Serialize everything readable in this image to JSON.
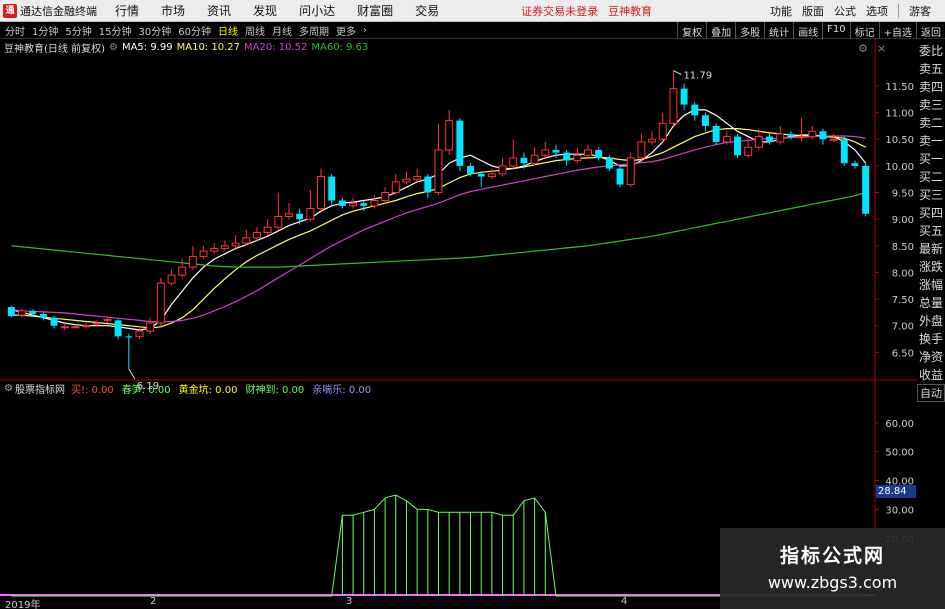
{
  "titlebar": {
    "app_name": "通达信金融终端",
    "menus": [
      "行情",
      "市场",
      "资讯",
      "发现",
      "问小达",
      "财富圈",
      "交易"
    ],
    "notice": "证券交易未登录",
    "notice2": "豆神教育",
    "right_items": [
      "功能",
      "版面",
      "公式",
      "选项",
      "游客"
    ]
  },
  "toolbar": {
    "periods": [
      "分时",
      "1分钟",
      "5分钟",
      "15分钟",
      "30分钟",
      "60分钟",
      "日线",
      "周线",
      "月线",
      "多周期",
      "更多"
    ],
    "active_period": "日线",
    "right_buttons": [
      "复权",
      "叠加",
      "多股",
      "统计",
      "画线",
      "F10",
      "标记",
      "+自选",
      "返回"
    ]
  },
  "info": {
    "stock": "豆神教育(日线 前复权)",
    "ma5": "MA5: 9.99",
    "ma10": "MA10: 10.27",
    "ma20": "MA20: 10.52",
    "ma60": "MA60: 9.63"
  },
  "colors": {
    "up": "#ff3333",
    "down": "#00e5ff",
    "ma5": "#ffffff",
    "ma10": "#ffff66",
    "ma20": "#cc44cc",
    "ma60": "#33bb33",
    "indicator": "#66ff66",
    "axis": "#aa0000"
  },
  "price_axis": [
    "11.50",
    "11.00",
    "10.50",
    "10.00",
    "9.50",
    "9.00",
    "8.50",
    "8.00",
    "7.50",
    "7.00",
    "6.50"
  ],
  "price_annotations": {
    "high": "11.79",
    "low": "6.19"
  },
  "side_panel": [
    "委比",
    "卖五",
    "卖四",
    "卖三",
    "卖二",
    "卖一",
    "买一",
    "买二",
    "买三",
    "买四",
    "买五",
    "最新",
    "涨跌",
    "涨幅",
    "总量",
    "外盘",
    "换手",
    "净资",
    "收益"
  ],
  "auto_label": "自动",
  "indicator": {
    "name": "股票指标网",
    "fields": [
      {
        "label": "买!",
        "value": "0.00",
        "color": "#ff4444"
      },
      {
        "label": "春笋",
        "value": "0.00",
        "color": "#66ff66"
      },
      {
        "label": "黄金坑",
        "value": "0.00",
        "color": "#ffff00"
      },
      {
        "label": "财神到",
        "value": "0.00",
        "color": "#66ff66"
      },
      {
        "label": "亲喘乐",
        "value": "0.00",
        "color": "#9999ff"
      }
    ],
    "axis": [
      "60.00",
      "50.00",
      "40.00",
      "30.00",
      "20.00"
    ],
    "current": "28.84"
  },
  "xaxis": [
    {
      "label": "2019年"
    },
    {
      "label": "2"
    },
    {
      "label": "3"
    },
    {
      "label": "4"
    }
  ],
  "watermark": {
    "line1": "指标公式网",
    "line2": "www.zbgs3.com"
  },
  "chart_data": {
    "type": "candlestick",
    "ylim": [
      6.0,
      12.1
    ],
    "candles": [
      [
        7.35,
        7.18,
        7.38,
        7.15
      ],
      [
        7.2,
        7.28,
        7.32,
        7.15
      ],
      [
        7.28,
        7.22,
        7.3,
        7.18
      ],
      [
        7.22,
        7.15,
        7.25,
        7.1
      ],
      [
        7.15,
        7.0,
        7.18,
        6.95
      ],
      [
        6.98,
        6.98,
        7.05,
        6.92
      ],
      [
        6.98,
        6.98,
        7.02,
        6.95
      ],
      [
        6.98,
        7.0,
        7.05,
        6.95
      ],
      [
        7.05,
        7.05,
        7.1,
        7.0
      ],
      [
        7.1,
        7.12,
        7.18,
        7.05
      ],
      [
        7.1,
        6.8,
        7.12,
        6.75
      ],
      [
        6.8,
        6.78,
        6.85,
        6.19
      ],
      [
        6.8,
        6.9,
        7.0,
        6.75
      ],
      [
        6.9,
        7.05,
        7.15,
        6.85
      ],
      [
        7.05,
        7.8,
        7.9,
        7.0
      ],
      [
        7.8,
        7.95,
        8.05,
        7.75
      ],
      [
        7.95,
        8.1,
        8.25,
        7.9
      ],
      [
        8.1,
        8.3,
        8.5,
        8.05
      ],
      [
        8.3,
        8.4,
        8.5,
        8.25
      ],
      [
        8.4,
        8.45,
        8.55,
        8.35
      ],
      [
        8.45,
        8.5,
        8.6,
        8.4
      ],
      [
        8.5,
        8.55,
        8.7,
        8.45
      ],
      [
        8.55,
        8.65,
        8.8,
        8.5
      ],
      [
        8.65,
        8.75,
        8.85,
        8.6
      ],
      [
        8.75,
        8.85,
        9.0,
        8.7
      ],
      [
        8.85,
        9.05,
        9.5,
        8.8
      ],
      [
        9.05,
        9.1,
        9.3,
        9.0
      ],
      [
        9.1,
        9.0,
        9.2,
        8.9
      ],
      [
        9.0,
        9.2,
        9.55,
        8.95
      ],
      [
        9.2,
        9.8,
        9.95,
        9.15
      ],
      [
        9.8,
        9.35,
        9.85,
        9.25
      ],
      [
        9.35,
        9.25,
        9.4,
        9.2
      ],
      [
        9.25,
        9.3,
        9.4,
        9.2
      ],
      [
        9.3,
        9.25,
        9.35,
        9.15
      ],
      [
        9.25,
        9.35,
        9.45,
        9.2
      ],
      [
        9.35,
        9.5,
        9.6,
        9.3
      ],
      [
        9.5,
        9.7,
        9.85,
        9.45
      ],
      [
        9.7,
        9.75,
        9.9,
        9.65
      ],
      [
        9.75,
        9.8,
        9.95,
        9.7
      ],
      [
        9.8,
        9.5,
        9.85,
        9.4
      ],
      [
        9.5,
        10.3,
        10.8,
        9.45
      ],
      [
        10.3,
        10.85,
        11.05,
        10.2
      ],
      [
        10.85,
        10.0,
        10.9,
        9.9
      ],
      [
        10.0,
        9.85,
        10.05,
        9.8
      ],
      [
        9.85,
        9.8,
        9.9,
        9.6
      ],
      [
        9.8,
        9.85,
        9.95,
        9.75
      ],
      [
        9.85,
        10.0,
        10.15,
        9.8
      ],
      [
        10.0,
        10.15,
        10.5,
        9.95
      ],
      [
        10.15,
        10.05,
        10.25,
        9.95
      ],
      [
        10.05,
        10.2,
        10.35,
        10.0
      ],
      [
        10.2,
        10.3,
        10.45,
        10.15
      ],
      [
        10.3,
        10.25,
        10.4,
        10.15
      ],
      [
        10.25,
        10.1,
        10.3,
        10.0
      ],
      [
        10.1,
        10.2,
        10.35,
        10.05
      ],
      [
        10.2,
        10.3,
        10.4,
        10.15
      ],
      [
        10.3,
        10.15,
        10.35,
        10.1
      ],
      [
        10.15,
        9.95,
        10.2,
        9.9
      ],
      [
        9.95,
        9.65,
        10.0,
        9.6
      ],
      [
        9.65,
        10.15,
        10.25,
        9.6
      ],
      [
        10.15,
        10.45,
        10.6,
        10.1
      ],
      [
        10.45,
        10.5,
        10.65,
        10.4
      ],
      [
        10.5,
        10.8,
        11.0,
        10.45
      ],
      [
        10.8,
        11.45,
        11.79,
        10.75
      ],
      [
        11.45,
        11.15,
        11.55,
        11.05
      ],
      [
        11.15,
        10.95,
        11.2,
        10.85
      ],
      [
        10.95,
        10.75,
        11.0,
        10.65
      ],
      [
        10.75,
        10.45,
        10.8,
        10.4
      ],
      [
        10.45,
        10.55,
        10.65,
        10.4
      ],
      [
        10.55,
        10.2,
        10.6,
        10.15
      ],
      [
        10.2,
        10.35,
        10.5,
        10.15
      ],
      [
        10.35,
        10.55,
        10.7,
        10.3
      ],
      [
        10.55,
        10.45,
        10.6,
        10.4
      ],
      [
        10.45,
        10.6,
        10.75,
        10.4
      ],
      [
        10.6,
        10.55,
        10.65,
        10.5
      ],
      [
        10.55,
        10.55,
        10.9,
        10.45
      ],
      [
        10.55,
        10.65,
        10.75,
        10.5
      ],
      [
        10.65,
        10.5,
        10.7,
        10.4
      ],
      [
        10.5,
        10.5,
        10.6,
        10.45
      ],
      [
        10.5,
        10.05,
        10.55,
        10.0
      ],
      [
        10.05,
        10.0,
        10.1,
        9.95
      ],
      [
        10.0,
        9.1,
        10.05,
        9.05
      ]
    ],
    "ma": {
      "ma5": [
        7.3,
        7.25,
        7.2,
        7.15,
        7.1,
        7.05,
        7.02,
        7.0,
        7.0,
        7.0,
        6.98,
        6.95,
        6.92,
        6.95,
        7.1,
        7.4,
        7.65,
        7.9,
        8.1,
        8.25,
        8.35,
        8.45,
        8.52,
        8.6,
        8.68,
        8.78,
        8.88,
        8.95,
        9.02,
        9.15,
        9.25,
        9.3,
        9.32,
        9.35,
        9.38,
        9.42,
        9.5,
        9.6,
        9.7,
        9.75,
        9.85,
        10.05,
        10.15,
        10.2,
        10.1,
        10.0,
        9.95,
        9.95,
        10.0,
        10.08,
        10.15,
        10.2,
        10.22,
        10.22,
        10.22,
        10.18,
        10.1,
        10.0,
        10.0,
        10.1,
        10.25,
        10.45,
        10.75,
        10.95,
        11.05,
        11.05,
        10.95,
        10.8,
        10.65,
        10.55,
        10.45,
        10.45,
        10.5,
        10.55,
        10.58,
        10.58,
        10.56,
        10.55,
        10.45,
        10.3,
        10.05
      ],
      "ma10": [
        7.2,
        7.2,
        7.18,
        7.16,
        7.14,
        7.12,
        7.1,
        7.08,
        7.06,
        7.04,
        7.02,
        7.0,
        6.98,
        6.96,
        6.98,
        7.05,
        7.15,
        7.3,
        7.5,
        7.7,
        7.88,
        8.05,
        8.2,
        8.32,
        8.42,
        8.52,
        8.62,
        8.7,
        8.78,
        8.88,
        8.98,
        9.08,
        9.15,
        9.2,
        9.25,
        9.3,
        9.35,
        9.42,
        9.48,
        9.52,
        9.58,
        9.68,
        9.78,
        9.85,
        9.88,
        9.9,
        9.92,
        9.95,
        9.98,
        10.02,
        10.06,
        10.1,
        10.12,
        10.14,
        10.15,
        10.16,
        10.15,
        10.12,
        10.1,
        10.12,
        10.18,
        10.25,
        10.35,
        10.45,
        10.55,
        10.62,
        10.68,
        10.7,
        10.7,
        10.68,
        10.65,
        10.62,
        10.6,
        10.58,
        10.57,
        10.56,
        10.55,
        10.54,
        10.52,
        10.45,
        10.35
      ],
      "ma20": [
        7.3,
        7.28,
        7.27,
        7.26,
        7.25,
        7.24,
        7.22,
        7.2,
        7.18,
        7.16,
        7.14,
        7.12,
        7.1,
        7.08,
        7.07,
        7.08,
        7.1,
        7.14,
        7.2,
        7.28,
        7.36,
        7.45,
        7.55,
        7.66,
        7.78,
        7.9,
        8.02,
        8.14,
        8.26,
        8.38,
        8.5,
        8.6,
        8.7,
        8.8,
        8.88,
        8.96,
        9.04,
        9.12,
        9.18,
        9.24,
        9.3,
        9.38,
        9.46,
        9.52,
        9.56,
        9.6,
        9.64,
        9.68,
        9.72,
        9.76,
        9.8,
        9.84,
        9.88,
        9.92,
        9.95,
        9.98,
        10.0,
        10.02,
        10.04,
        10.06,
        10.08,
        10.12,
        10.18,
        10.24,
        10.3,
        10.35,
        10.4,
        10.44,
        10.46,
        10.48,
        10.5,
        10.51,
        10.52,
        10.53,
        10.54,
        10.55,
        10.56,
        10.56,
        10.56,
        10.55,
        10.52
      ],
      "ma60": [
        8.5,
        8.48,
        8.46,
        8.44,
        8.42,
        8.4,
        8.38,
        8.36,
        8.34,
        8.32,
        8.3,
        8.28,
        8.26,
        8.24,
        8.22,
        8.2,
        8.18,
        8.16,
        8.14,
        8.12,
        8.11,
        8.1,
        8.1,
        8.1,
        8.1,
        8.1,
        8.11,
        8.12,
        8.13,
        8.14,
        8.15,
        8.16,
        8.17,
        8.18,
        8.19,
        8.2,
        8.21,
        8.22,
        8.23,
        8.24,
        8.25,
        8.26,
        8.27,
        8.28,
        8.3,
        8.32,
        8.34,
        8.36,
        8.38,
        8.4,
        8.42,
        8.44,
        8.46,
        8.48,
        8.5,
        8.53,
        8.56,
        8.59,
        8.62,
        8.65,
        8.68,
        8.72,
        8.76,
        8.8,
        8.84,
        8.88,
        8.92,
        8.96,
        9.0,
        9.04,
        9.08,
        9.12,
        9.16,
        9.2,
        9.24,
        9.28,
        9.32,
        9.36,
        9.4,
        9.44,
        9.5
      ]
    },
    "indicator_ylim": [
      0,
      70
    ],
    "indicator_values": [
      0,
      0,
      0,
      0,
      0,
      0,
      0,
      0,
      0,
      0,
      0,
      0,
      0,
      0,
      0,
      0,
      0,
      0,
      0,
      0,
      0,
      0,
      0,
      0,
      0,
      0,
      0,
      0,
      0,
      0,
      0,
      28,
      28,
      29,
      30,
      34,
      35,
      33,
      30,
      30,
      29,
      29,
      29,
      29,
      29,
      29,
      28,
      28,
      33,
      34,
      29,
      0,
      0,
      0,
      0,
      0,
      0,
      0,
      0,
      0,
      0,
      0,
      0,
      0,
      0,
      0,
      0,
      0,
      0,
      0,
      0,
      0,
      0,
      0,
      0,
      0,
      0,
      0,
      0,
      0,
      0
    ]
  }
}
